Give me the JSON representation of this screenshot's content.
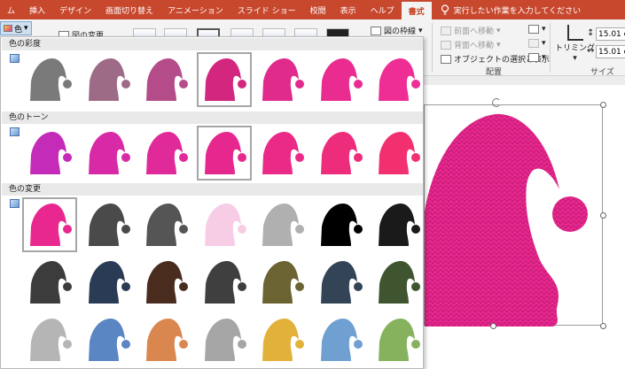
{
  "tabs": [
    {
      "label": "ム",
      "active": false
    },
    {
      "label": "挿入",
      "active": false
    },
    {
      "label": "デザイン",
      "active": false
    },
    {
      "label": "画面切り替え",
      "active": false
    },
    {
      "label": "アニメーション",
      "active": false
    },
    {
      "label": "スライド ショー",
      "active": false
    },
    {
      "label": "校閲",
      "active": false
    },
    {
      "label": "表示",
      "active": false
    },
    {
      "label": "ヘルプ",
      "active": false
    },
    {
      "label": "書式",
      "active": true
    }
  ],
  "tell_me": "実行したい作業を入力してください",
  "ribbon": {
    "color_button": "色",
    "change_picture": "図の変更",
    "picture_border": "図の枠線",
    "bring_forward": "前面へ移動",
    "send_backward": "背面へ移動",
    "selection_pane": "オブジェクトの選択と表示",
    "arrange_label": "配置",
    "crop_label": "トリミング",
    "size_label": "サイズ",
    "height_value": "15.01 c",
    "width_value": "15.01 c"
  },
  "sections": {
    "saturation": "色の彩度",
    "tone": "色のトーン",
    "recolor": "色の変更"
  },
  "colors": {
    "tab_bar": "#c8482e",
    "hat_pink": "#e8288f"
  },
  "swatch_rows": {
    "saturation": [
      "#7a7a7a",
      "#9e6b86",
      "#b54c8a",
      "#d2267f",
      "#e02a8c",
      "#ea2c91",
      "#ee2e94"
    ],
    "tone": [
      "#c42bb8",
      "#d82aa6",
      "#e02a99",
      "#e6288e",
      "#ea2a86",
      "#ee2c7c",
      "#f23070"
    ],
    "recolor_1": [
      "#e8288f",
      "#4a4a4a",
      "#555555",
      "#f7cde6",
      "#b0b0b0",
      "#000000",
      "#1a1a1a"
    ],
    "recolor_2": [
      "#3c3c3c",
      "#2a3b55",
      "#4a2c1f",
      "#3f3f3f",
      "#6b6432",
      "#344457",
      "#3f5530"
    ],
    "recolor_3": [
      "#b5b5b5",
      "#5b86c4",
      "#d9874e",
      "#a6a6a6",
      "#e2b13a",
      "#6fa0d1",
      "#86b25d"
    ]
  }
}
